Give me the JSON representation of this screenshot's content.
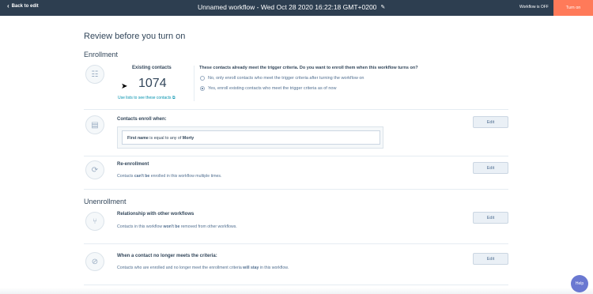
{
  "topbar": {
    "back_label": "Back to edit",
    "title": "Unnamed workflow - Wed Oct 28 2020 16:22:18 GMT+0200",
    "status": "Workflow is OFF",
    "turn_on_label": "Turn on"
  },
  "page": {
    "heading": "Review before you turn on"
  },
  "enrollment": {
    "section_title": "Enrollment",
    "existing_label": "Existing contacts",
    "existing_count": "1074",
    "lists_link": "Use lists to see these contacts",
    "question": "These contacts already meet the trigger criteria. Do you want to enroll them when this workflow turns on?",
    "option_no": "No, only enroll contacts who meet the trigger criteria after turning the workflow on",
    "option_yes": "Yes, enroll existing contacts who meet the trigger criteria as of now",
    "selected": "yes",
    "enroll_when_title": "Contacts enroll when:",
    "filter": {
      "property": "First name",
      "operator": " is equal to any of ",
      "value": "Morty"
    },
    "reenroll_title": "Re-enrollment",
    "reenroll_pre": "Contacts ",
    "reenroll_bold": "can't be",
    "reenroll_post": " enrolled in this workflow multiple times.",
    "edit_label": "Edit"
  },
  "unenrollment": {
    "section_title": "Unenrollment",
    "relationship_title": "Relationship with other workflows",
    "relationship_pre": "Contacts in this workflow ",
    "relationship_bold": "won't be",
    "relationship_post": " removed from other workflows.",
    "criteria_title": "When a contact no longer meets the criteria:",
    "criteria_pre": "Contacts who are enrolled and no longer meet the enrollment criteria ",
    "criteria_bold": "will stay",
    "criteria_post": " in this workflow.",
    "edit_label": "Edit"
  },
  "help_label": "Help",
  "colors": {
    "topbar": "#2d3e50",
    "accent": "#ff7a59",
    "link": "#0091ae",
    "help": "#6a78d1"
  }
}
